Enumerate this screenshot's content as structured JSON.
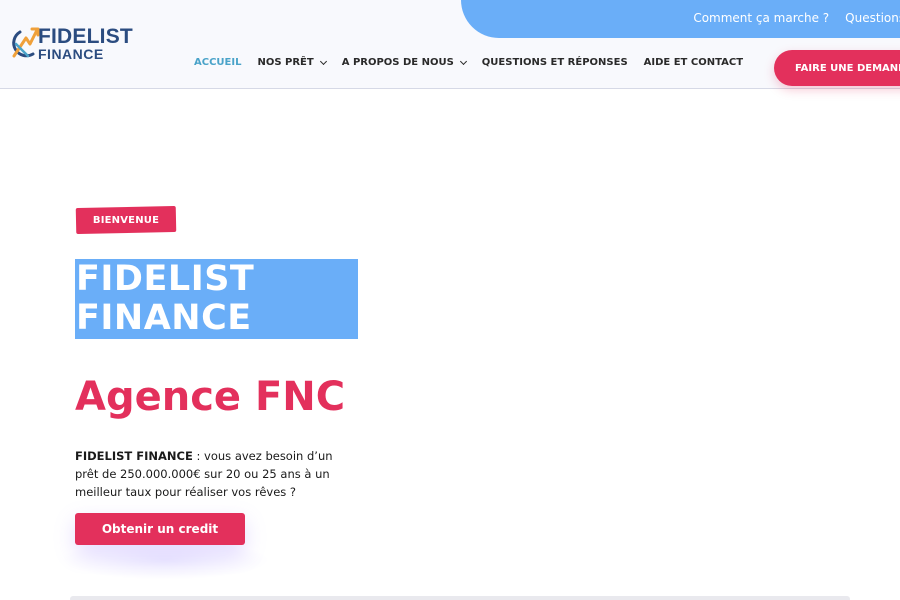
{
  "brand": {
    "name_line1": "FIDELIST",
    "name_line2": "FINANCE",
    "colors": {
      "primary_blue": "#6aaef8",
      "accent_pink": "#e3305c",
      "logo_navy": "#2b4c80",
      "nav_active": "#4aa3c9"
    }
  },
  "topbar": {
    "links": [
      "Comment ça marche ?",
      "Questions et"
    ]
  },
  "nav": {
    "items": [
      {
        "label": "ACCUEIL",
        "active": true,
        "dropdown": false
      },
      {
        "label": "NOS PRÊT",
        "active": false,
        "dropdown": true
      },
      {
        "label": "A PROPOS DE NOUS",
        "active": false,
        "dropdown": true
      },
      {
        "label": "QUESTIONS ET RÉPONSES",
        "active": false,
        "dropdown": false
      },
      {
        "label": "AIDE ET CONTACT",
        "active": false,
        "dropdown": false
      }
    ],
    "cta_label": "FAIRE UNE DEMANDE"
  },
  "hero": {
    "badge": "BIENVENUE",
    "title_line1": "FIDELIST",
    "title_line2": "FINANCE",
    "subtitle": "Agence FNC",
    "description_bold": "FIDELIST FINANCE",
    "description_rest": " : vous avez besoin d’un prêt de 250.000.000€ sur 20 ou 25 ans à un meilleur taux pour réaliser vos rêves ?",
    "cta_label": "Obtenir un credit"
  },
  "icons": {
    "logo": "logo-arrow-circle-icon",
    "dropdown": "chevron-down-icon"
  }
}
